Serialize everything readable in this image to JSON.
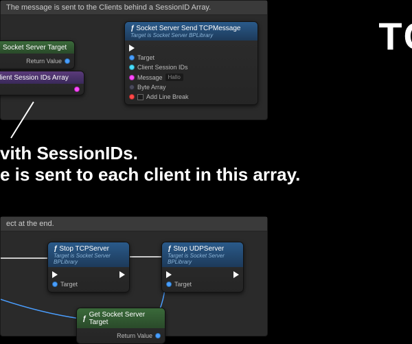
{
  "big_label": "TC",
  "annotation": {
    "line1": "vith SessionIDs.",
    "line2": "e is sent to each client in this array."
  },
  "panel1": {
    "header": "The message is sent to the Clients behind a SessionID Array.",
    "node_target": {
      "title": "Socket Server Target",
      "pin": "Return Value"
    },
    "node_array": {
      "title": "Client Session IDs Array"
    },
    "node_send": {
      "title": "Socket Server Send TCPMessage",
      "subtitle": "Target is Socket Server BPLibrary",
      "pins": {
        "target": "Target",
        "session_ids": "Client Session IDs",
        "message": "Message",
        "message_value": "Hallo",
        "byte_array": "Byte Array",
        "line_break": "Add Line Break"
      }
    }
  },
  "panel2": {
    "header": "ect at the end.",
    "node_stop_tcp": {
      "title": "Stop TCPServer",
      "subtitle": "Target is Socket Server BPLibrary",
      "pin": "Target"
    },
    "node_stop_udp": {
      "title": "Stop UDPServer",
      "subtitle": "Target is Socket Server BPLibrary",
      "pin": "Target"
    },
    "node_get_target": {
      "title": "Get Socket Server Target",
      "pin": "Return Value"
    }
  }
}
